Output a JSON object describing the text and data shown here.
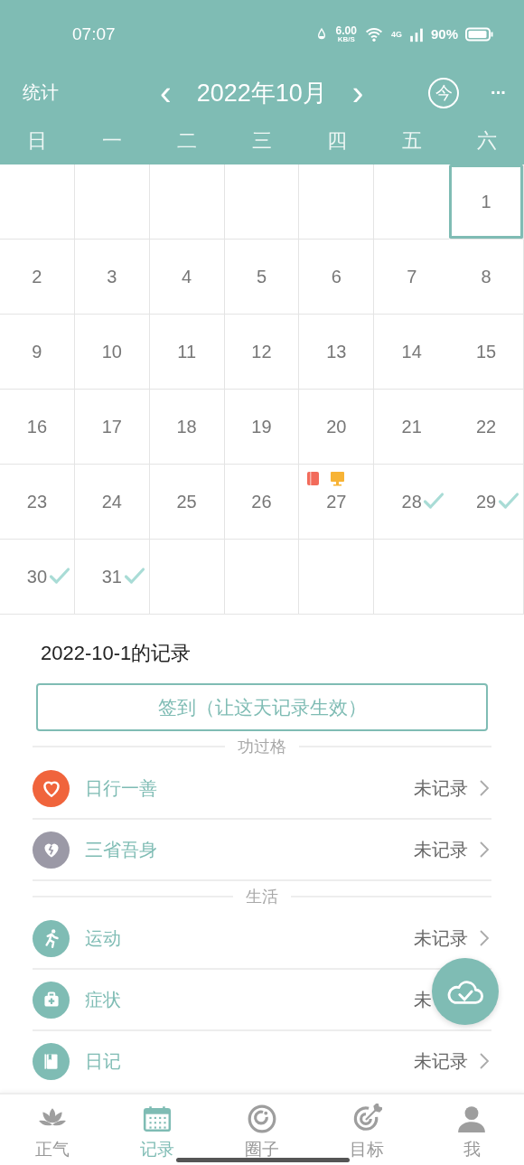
{
  "status_bar": {
    "time": "07:07",
    "speed": "6.00",
    "speed_unit": "KB/S",
    "network": "4G",
    "battery": "90%"
  },
  "header": {
    "left": "统计",
    "title": "2022年10月",
    "prev": "‹",
    "next": "›",
    "today": "今",
    "more": "···"
  },
  "weekdays": [
    "日",
    "一",
    "二",
    "三",
    "四",
    "五",
    "六"
  ],
  "calendar": {
    "cells": [
      {
        "kind": "blank"
      },
      {
        "kind": "blank"
      },
      {
        "kind": "blank"
      },
      {
        "kind": "blank"
      },
      {
        "kind": "blank"
      },
      {
        "kind": "blank"
      },
      {
        "kind": "day",
        "day": "1",
        "selected": true,
        "checked": false
      },
      {
        "kind": "day",
        "day": "2",
        "selected": false,
        "checked": false
      },
      {
        "kind": "day",
        "day": "3",
        "selected": false,
        "checked": false
      },
      {
        "kind": "day",
        "day": "4",
        "selected": false,
        "checked": false
      },
      {
        "kind": "day",
        "day": "5",
        "selected": false,
        "checked": false
      },
      {
        "kind": "day",
        "day": "6",
        "selected": false,
        "checked": false
      },
      {
        "kind": "day",
        "day": "7",
        "selected": false,
        "checked": false
      },
      {
        "kind": "day",
        "day": "8",
        "selected": false,
        "checked": false
      },
      {
        "kind": "day",
        "day": "9",
        "selected": false,
        "checked": false
      },
      {
        "kind": "day",
        "day": "10",
        "selected": false,
        "checked": false
      },
      {
        "kind": "day",
        "day": "11",
        "selected": false,
        "checked": false
      },
      {
        "kind": "day",
        "day": "12",
        "selected": false,
        "checked": false
      },
      {
        "kind": "day",
        "day": "13",
        "selected": false,
        "checked": false
      },
      {
        "kind": "day",
        "day": "14",
        "selected": false,
        "checked": false
      },
      {
        "kind": "day",
        "day": "15",
        "selected": false,
        "checked": false
      },
      {
        "kind": "day",
        "day": "16",
        "selected": false,
        "checked": false
      },
      {
        "kind": "day",
        "day": "17",
        "selected": false,
        "checked": false
      },
      {
        "kind": "day",
        "day": "18",
        "selected": false,
        "checked": false
      },
      {
        "kind": "day",
        "day": "19",
        "selected": false,
        "checked": false
      },
      {
        "kind": "day",
        "day": "20",
        "selected": false,
        "checked": false
      },
      {
        "kind": "day",
        "day": "21",
        "selected": false,
        "checked": false
      },
      {
        "kind": "day",
        "day": "22",
        "selected": false,
        "checked": false
      },
      {
        "kind": "day",
        "day": "23",
        "selected": false,
        "checked": false
      },
      {
        "kind": "day",
        "day": "24",
        "selected": false,
        "checked": false
      },
      {
        "kind": "day",
        "day": "25",
        "selected": false,
        "checked": false
      },
      {
        "kind": "day",
        "day": "26",
        "selected": false,
        "checked": false
      },
      {
        "kind": "day",
        "day": "27",
        "selected": false,
        "checked": false,
        "markers": [
          {
            "kind": "book",
            "color": "#f26b5b"
          },
          {
            "kind": "monitor",
            "color": "#f7b335"
          }
        ]
      },
      {
        "kind": "day",
        "day": "28",
        "selected": false,
        "checked": true
      },
      {
        "kind": "day",
        "day": "29",
        "selected": false,
        "checked": true
      },
      {
        "kind": "day",
        "day": "30",
        "selected": false,
        "checked": true
      },
      {
        "kind": "day",
        "day": "31",
        "selected": false,
        "checked": true
      },
      {
        "kind": "blank"
      },
      {
        "kind": "blank"
      },
      {
        "kind": "blank"
      },
      {
        "kind": "blank"
      },
      {
        "kind": "blank"
      }
    ]
  },
  "record": {
    "title": "2022-10-1的记录",
    "checkin_button": "签到（让这天记录生效）",
    "groups": [
      {
        "title": "功过格",
        "items": [
          {
            "kind": "heart",
            "color": "#f0643c",
            "label": "日行一善",
            "status": "未记录",
            "chevron": true
          },
          {
            "kind": "broken-heart",
            "color": "#9b99a6",
            "label": "三省吾身",
            "status": "未记录",
            "chevron": true
          }
        ]
      },
      {
        "title": "生活",
        "items": [
          {
            "kind": "runner",
            "color": "#7fbcb4",
            "label": "运动",
            "status": "未记录",
            "chevron": true
          },
          {
            "kind": "medkit",
            "color": "#7fbcb4",
            "label": "症状",
            "status": "未",
            "chevron": false
          },
          {
            "kind": "book",
            "color": "#7fbcb4",
            "label": "日记",
            "status": "未记录",
            "chevron": true
          }
        ]
      }
    ]
  },
  "bottom_nav": [
    {
      "kind": "lotus",
      "label": "正气",
      "selected": false
    },
    {
      "kind": "calendar",
      "label": "记录",
      "selected": true
    },
    {
      "kind": "ring",
      "label": "圈子",
      "selected": false
    },
    {
      "kind": "target",
      "label": "目标",
      "selected": false
    },
    {
      "kind": "person",
      "label": "我",
      "selected": false
    }
  ]
}
